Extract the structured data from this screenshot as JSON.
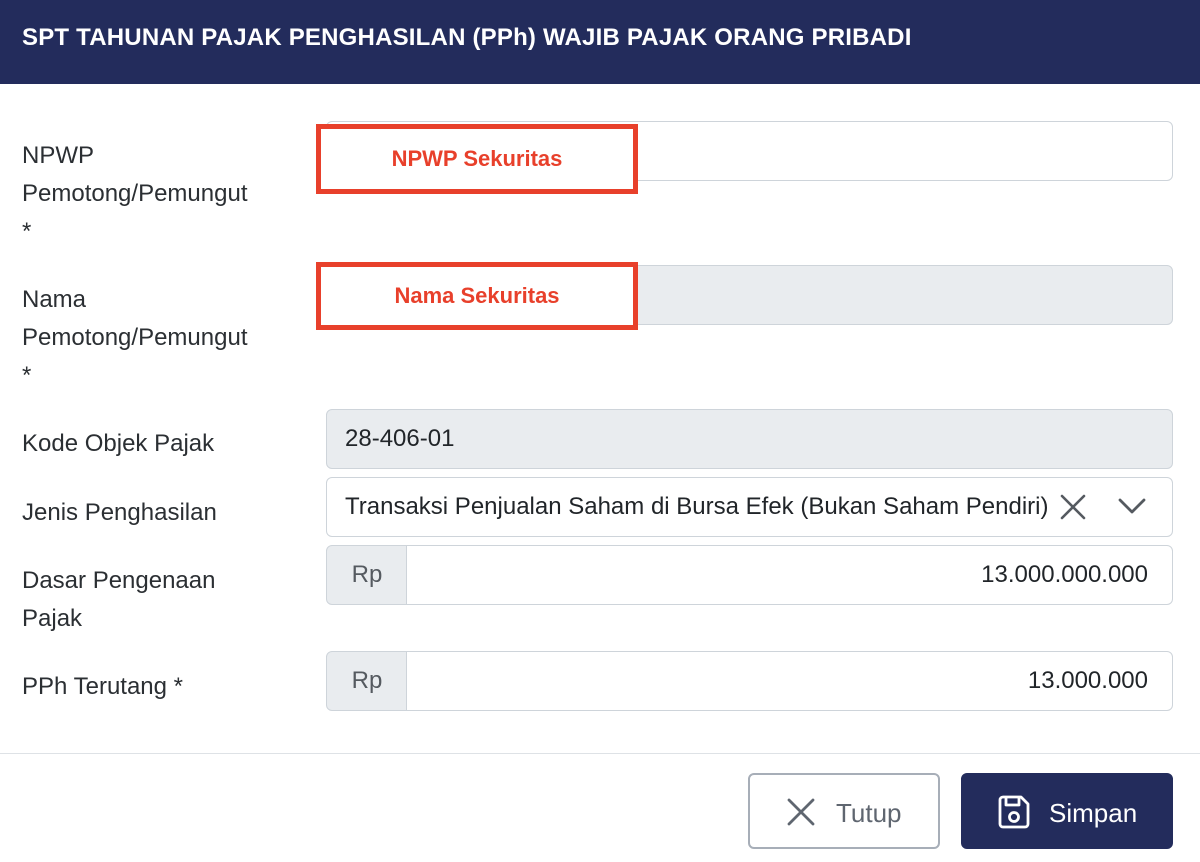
{
  "modal": {
    "title": "SPT TAHUNAN PAJAK PENGHASILAN (PPh) WAJIB PAJAK ORANG PRIBADI"
  },
  "form": {
    "npwp": {
      "label": "NPWP\nPemotong/Pemungut\n*",
      "value": "",
      "redaction_text": "NPWP Sekuritas"
    },
    "nama": {
      "label": "Nama\nPemotong/Pemungut\n*",
      "value": "",
      "redaction_text": "Nama Sekuritas"
    },
    "kode_objek": {
      "label": "Kode Objek Pajak",
      "value": "28-406-01"
    },
    "jenis_penghasilan": {
      "label": "Jenis Penghasilan",
      "selected": "Transaksi Penjualan Saham di Bursa Efek (Bukan Saham Pendiri)"
    },
    "dasar_pengenaan": {
      "label": "Dasar Pengenaan\nPajak",
      "currency": "Rp",
      "value": "13.000.000.000"
    },
    "pph_terutang": {
      "label": "PPh Terutang *",
      "currency": "Rp",
      "value": "13.000.000"
    }
  },
  "footer": {
    "close_label": "Tutup",
    "save_label": "Simpan"
  },
  "icons": {
    "clear": "close-icon",
    "dropdown": "chevron-down-icon",
    "close_button": "x-icon",
    "save_button": "floppy-disk-icon"
  },
  "colors": {
    "header_bg": "#232c5c",
    "primary_button": "#232c5c",
    "redaction_red": "#e8402b",
    "readonly_bg": "#e9ecef"
  }
}
